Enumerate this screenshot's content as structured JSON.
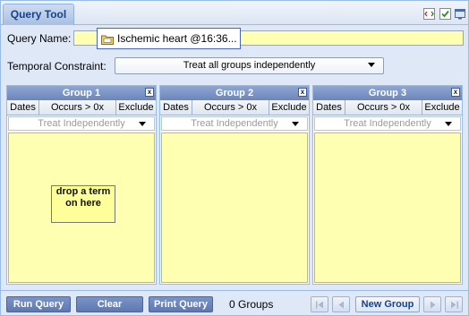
{
  "header": {
    "tab_label": "Query Tool"
  },
  "query_name": {
    "label": "Query Name:",
    "value": "Ischemic heart @16:36..."
  },
  "temporal": {
    "label": "Temporal Constraint:",
    "selected": "Treat all groups independently"
  },
  "groups": [
    {
      "title": "Group 1",
      "tabs": [
        "Dates",
        "Occurs > 0x",
        "Exclude"
      ],
      "timing": "Treat Independently",
      "drop_hint": "drop a term on here"
    },
    {
      "title": "Group 2",
      "tabs": [
        "Dates",
        "Occurs > 0x",
        "Exclude"
      ],
      "timing": "Treat Independently"
    },
    {
      "title": "Group 3",
      "tabs": [
        "Dates",
        "Occurs > 0x",
        "Exclude"
      ],
      "timing": "Treat Independently"
    }
  ],
  "toolbar": {
    "run_label": "Run Query",
    "clear_label": "Clear",
    "print_label": "Print Query",
    "group_count": "0 Groups",
    "new_group_label": "New Group"
  },
  "icons": {
    "header": [
      "xml-icon",
      "check-icon",
      "window-icon"
    ],
    "chip": "folder-icon",
    "nav": [
      "first-page-icon",
      "previous-page-icon",
      "next-page-icon",
      "last-page-icon"
    ]
  },
  "colors": {
    "panel_bg": "#dfe8f6",
    "group_header": "#7891c6",
    "drop_area": "#ffffb2",
    "button": "#6a83bc",
    "title_text": "#15428b"
  }
}
